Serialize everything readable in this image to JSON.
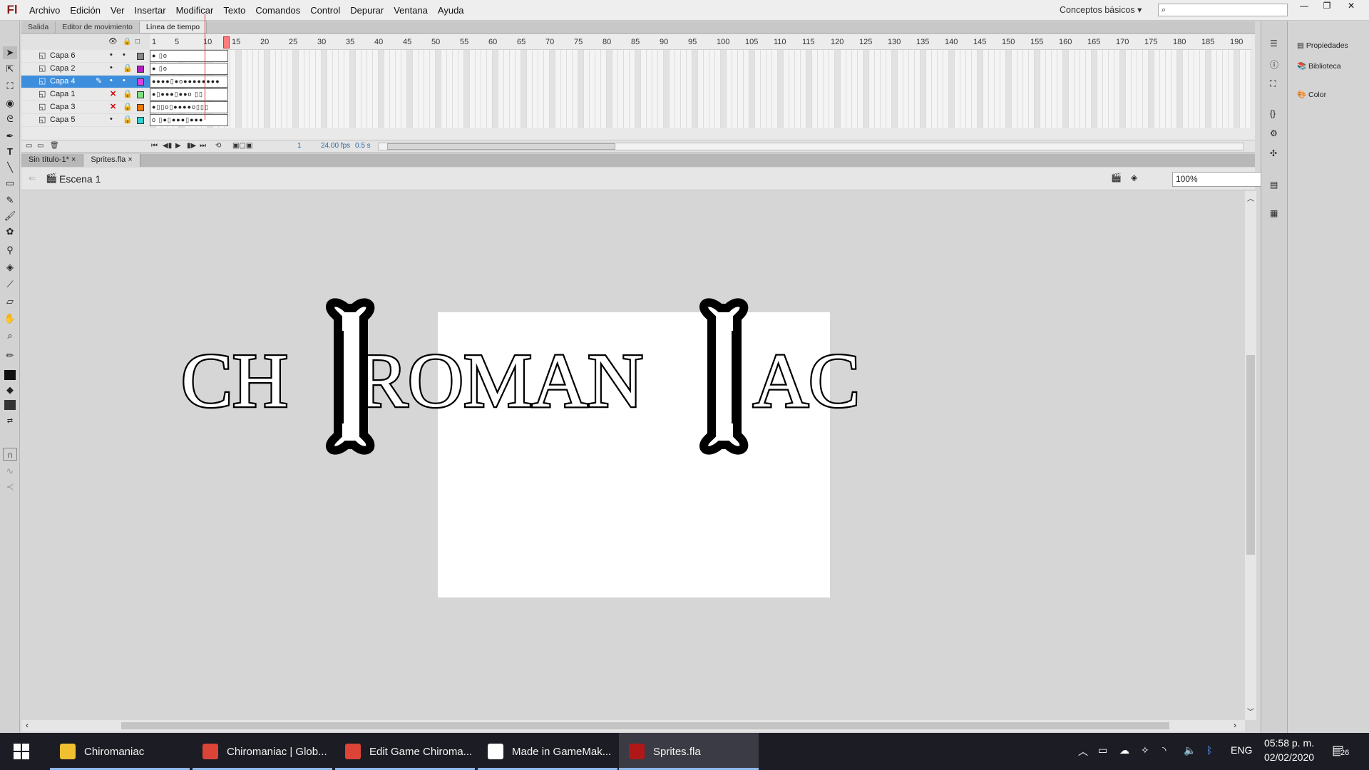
{
  "app": {
    "logo": "Fl",
    "workspace": "Conceptos básicos ▾"
  },
  "menu": [
    "Archivo",
    "Edición",
    "Ver",
    "Insertar",
    "Modificar",
    "Texto",
    "Comandos",
    "Control",
    "Depurar",
    "Ventana",
    "Ayuda"
  ],
  "window_controls": {
    "minimize": "—",
    "restore": "❐",
    "close": "✕"
  },
  "panel_tabs": [
    "Salida",
    "Editor de movimiento",
    "Línea de tiempo"
  ],
  "timeline": {
    "frame_numbers": [
      "1",
      "5",
      "10",
      "15",
      "20",
      "25",
      "30",
      "35",
      "40",
      "45",
      "50",
      "55",
      "60",
      "65",
      "70",
      "75",
      "80",
      "85",
      "90",
      "95",
      "100",
      "105",
      "110",
      "115",
      "120",
      "125",
      "130",
      "135",
      "140",
      "145",
      "150",
      "155",
      "160",
      "165",
      "170",
      "175",
      "180",
      "185",
      "190"
    ],
    "layers": [
      {
        "name": "Capa 6",
        "color": "#888888",
        "hidden": false,
        "frames": "●  ▯o"
      },
      {
        "name": "Capa 2",
        "color": "#b020c0",
        "hidden": false,
        "frames": "●  ▯o"
      },
      {
        "name": "Capa 4",
        "color": "#e040e0",
        "hidden": false,
        "frames": "●●●●▯●o●●●●●●●●"
      },
      {
        "name": "Capa 1",
        "color": "#80e080",
        "hidden": true,
        "frames": "●▯●●●▯●●o  ▯▯"
      },
      {
        "name": "Capa 3",
        "color": "#f07800",
        "hidden": true,
        "frames": "●▯▯o▯●●●●o▯▯▯"
      },
      {
        "name": "Capa 5",
        "color": "#30d0d0",
        "hidden": false,
        "frames": "o ▯●▯●●●▯●●● "
      }
    ],
    "current_frame": "1",
    "fps": "24.00 fps",
    "time": "0.5 s"
  },
  "doc_tabs": [
    "Sin título-1*",
    "Sprites.fla"
  ],
  "scene": {
    "name": "Escena 1",
    "zoom": "100%"
  },
  "artwork": {
    "text_left": "CH",
    "text_mid": "ROMAN",
    "text_right": "AC"
  },
  "right_panels": [
    "Propiedades",
    "Biblioteca",
    "Color"
  ],
  "taskbar": {
    "items": [
      {
        "label": "Chiromaniac",
        "icon": "folder-icon",
        "color": "#f0c030"
      },
      {
        "label": "Chiromaniac | Glob...",
        "icon": "chrome-icon",
        "color": "#db4437"
      },
      {
        "label": "Edit Game Chiroma...",
        "icon": "chrome-icon",
        "color": "#db4437"
      },
      {
        "label": "Made in GameMak...",
        "icon": "gamemaker-icon",
        "color": "#ffffff"
      },
      {
        "label": "Sprites.fla",
        "icon": "flash-icon",
        "color": "#b01818"
      }
    ],
    "lang": "ENG",
    "time": "05:58 p. m.",
    "date": "02/02/2020",
    "notifications": "26"
  }
}
